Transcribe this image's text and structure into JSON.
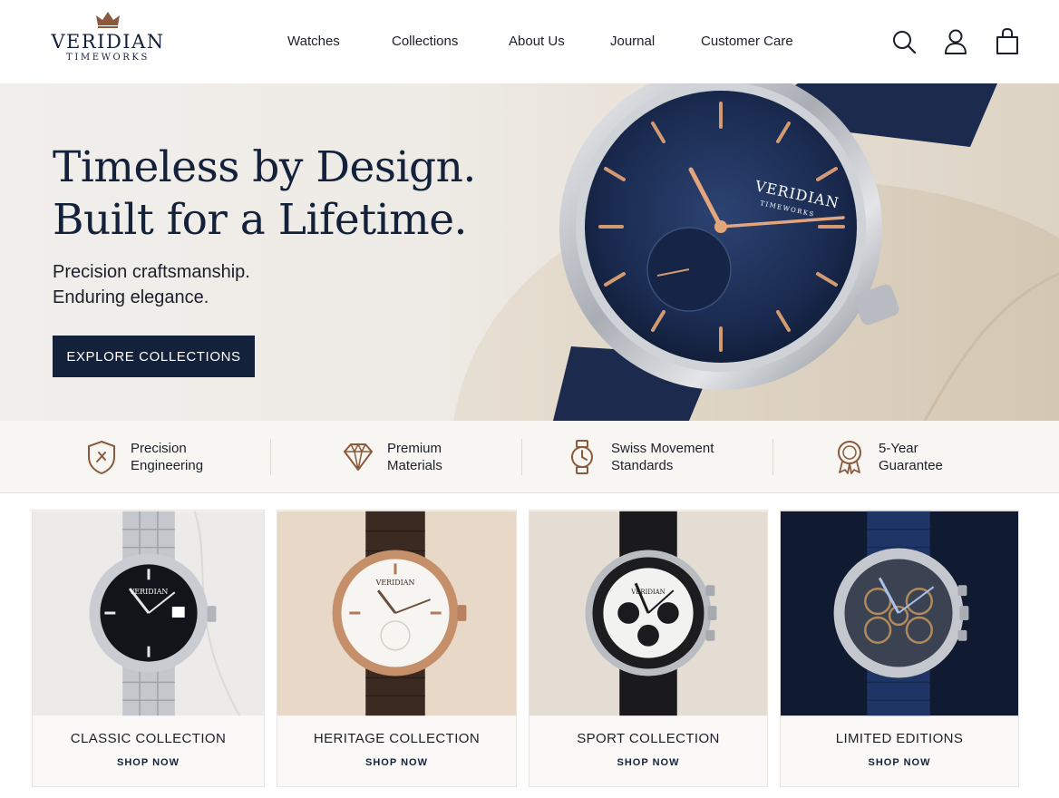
{
  "brand": {
    "name": "VERIDIAN",
    "tagline": "TIMEWORKS"
  },
  "nav": [
    {
      "label": "Watches"
    },
    {
      "label": "Collections"
    },
    {
      "label": "About Us"
    },
    {
      "label": "Journal"
    },
    {
      "label": "Customer Care"
    }
  ],
  "header_icons": [
    "search-icon",
    "account-icon",
    "shopping-bag-icon"
  ],
  "hero": {
    "title_line1": "Timeless by Design.",
    "title_line2": "Built for a Lifetime.",
    "subtitle_line1": "Precision craftsmanship.",
    "subtitle_line2": "Enduring elegance.",
    "cta_label": "EXPLORE COLLECTIONS",
    "watch_dial_brand": "VERIDIAN",
    "watch_dial_sub": "TIMEWORKS"
  },
  "features": [
    {
      "icon": "shield-icon",
      "line1": "Precision",
      "line2": "Engineering"
    },
    {
      "icon": "diamond-icon",
      "line1": "Premium",
      "line2": "Materials"
    },
    {
      "icon": "watch-icon",
      "line1": "Swiss Movement",
      "line2": "Standards"
    },
    {
      "icon": "award-ribbon-icon",
      "line1": "5-Year",
      "line2": "Guarantee"
    }
  ],
  "collections": [
    {
      "title": "CLASSIC COLLECTION",
      "cta": "SHOP NOW"
    },
    {
      "title": "HERITAGE COLLECTION",
      "cta": "SHOP NOW"
    },
    {
      "title": "SPORT COLLECTION",
      "cta": "SHOP NOW"
    },
    {
      "title": "LIMITED EDITIONS",
      "cta": "SHOP NOW"
    }
  ],
  "colors": {
    "navy": "#14213a",
    "accent_bronze": "#8a5a3c",
    "background_cream": "#f8f6f2"
  }
}
